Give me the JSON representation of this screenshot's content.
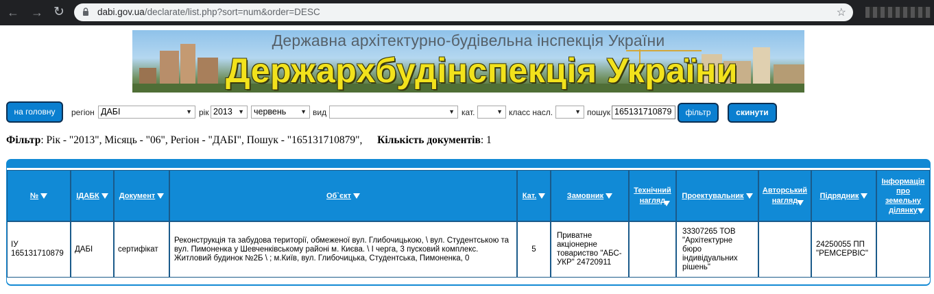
{
  "browser": {
    "url_host": "dabi.gov.ua",
    "url_path": "/declarate/list.php?sort=num&order=DESC"
  },
  "banner": {
    "subtitle": "Державна архітектурно-будівельна інспекція України",
    "title": "Держархбудінспекція України"
  },
  "filters": {
    "home_label": "на головну",
    "region_label": "регіон",
    "region_value": "ДАБІ",
    "year_label": "рік",
    "year_value": "2013",
    "month_value": "червень",
    "type_label": "вид",
    "type_value": "",
    "category_label": "кат.",
    "category_value": "",
    "class_label": "класс насл.",
    "class_value": "",
    "search_label": "пошук",
    "search_value": "165131710879",
    "filter_button": "фільтр",
    "reset_button": "скинути"
  },
  "summary": {
    "filter_key": "Фільтр",
    "filter_text": ": Рік - \"2013\", Місяць - \"06\", Регіон - \"ДАБІ\", Пошук - \"165131710879\",",
    "count_key": "Кількість документів",
    "count_text": ": 1"
  },
  "table": {
    "headers": [
      "№",
      "ІДАБК",
      "Документ",
      "Об`єкт",
      "Кат.",
      "Замовник",
      "Технічний нагляд",
      "Проектувальник",
      "Авторський нагляд",
      "Підрядник",
      "Інформація про земельну ділянку"
    ],
    "rows": [
      {
        "num": "ІУ 165131710879",
        "idabk": "ДАБІ",
        "document": "сертифікат",
        "object": "Реконструкція та забудова території, обмеженої вул. Глибочицькою, \\ вул. Студентською та вул. Пимоненка у Шевченківському районі м. Києва. \\ I черга, 3 пусковий комплекс. Житловий будинок №2Б \\ ; м.Київ, вул. Глибочицька, Студентська, Пимоненка, 0",
        "category": "5",
        "customer": "Приватне акціонерне товариство \"АБС-УКР\" 24720911",
        "tech_supervision": "",
        "designer": "33307265 ТОВ \"Архітектурне бюро індивідуальних рішень\"",
        "author_supervision": "",
        "contractor": "24250055 ПП \"РЕМСЕРВІС\"",
        "land_info": ""
      }
    ]
  }
}
